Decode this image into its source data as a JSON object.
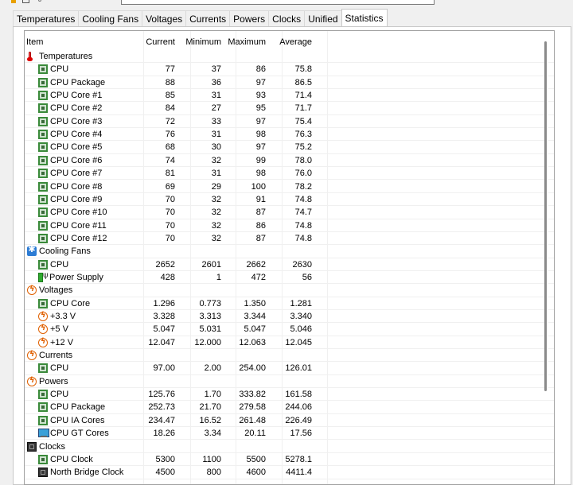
{
  "tabs": [
    "Temperatures",
    "Cooling Fans",
    "Voltages",
    "Currents",
    "Powers",
    "Clocks",
    "Unified",
    "Statistics"
  ],
  "active_tab": "Statistics",
  "columns": {
    "item": "Item",
    "current": "Current",
    "minimum": "Minimum",
    "maximum": "Maximum",
    "average": "Average"
  },
  "rows": [
    {
      "type": "group",
      "icon": "thermometer-icon",
      "label": "Temperatures"
    },
    {
      "type": "item",
      "icon": "cpu-chip-icon",
      "label": "CPU",
      "current": "77",
      "min": "37",
      "max": "86",
      "avg": "75.8"
    },
    {
      "type": "item",
      "icon": "cpu-chip-icon",
      "label": "CPU Package",
      "current": "88",
      "min": "36",
      "max": "97",
      "avg": "86.5"
    },
    {
      "type": "item",
      "icon": "cpu-chip-icon",
      "label": "CPU Core #1",
      "current": "85",
      "min": "31",
      "max": "93",
      "avg": "71.4"
    },
    {
      "type": "item",
      "icon": "cpu-chip-icon",
      "label": "CPU Core #2",
      "current": "84",
      "min": "27",
      "max": "95",
      "avg": "71.7"
    },
    {
      "type": "item",
      "icon": "cpu-chip-icon",
      "label": "CPU Core #3",
      "current": "72",
      "min": "33",
      "max": "97",
      "avg": "75.4"
    },
    {
      "type": "item",
      "icon": "cpu-chip-icon",
      "label": "CPU Core #4",
      "current": "76",
      "min": "31",
      "max": "98",
      "avg": "76.3"
    },
    {
      "type": "item",
      "icon": "cpu-chip-icon",
      "label": "CPU Core #5",
      "current": "68",
      "min": "30",
      "max": "97",
      "avg": "75.2"
    },
    {
      "type": "item",
      "icon": "cpu-chip-icon",
      "label": "CPU Core #6",
      "current": "74",
      "min": "32",
      "max": "99",
      "avg": "78.0"
    },
    {
      "type": "item",
      "icon": "cpu-chip-icon",
      "label": "CPU Core #7",
      "current": "81",
      "min": "31",
      "max": "98",
      "avg": "76.0"
    },
    {
      "type": "item",
      "icon": "cpu-chip-icon",
      "label": "CPU Core #8",
      "current": "69",
      "min": "29",
      "max": "100",
      "avg": "78.2"
    },
    {
      "type": "item",
      "icon": "cpu-chip-icon",
      "label": "CPU Core #9",
      "current": "70",
      "min": "32",
      "max": "91",
      "avg": "74.8"
    },
    {
      "type": "item",
      "icon": "cpu-chip-icon",
      "label": "CPU Core #10",
      "current": "70",
      "min": "32",
      "max": "87",
      "avg": "74.7"
    },
    {
      "type": "item",
      "icon": "cpu-chip-icon",
      "label": "CPU Core #11",
      "current": "70",
      "min": "32",
      "max": "86",
      "avg": "74.8"
    },
    {
      "type": "item",
      "icon": "cpu-chip-icon",
      "label": "CPU Core #12",
      "current": "70",
      "min": "32",
      "max": "87",
      "avg": "74.8"
    },
    {
      "type": "group",
      "icon": "fan-icon",
      "label": "Cooling Fans"
    },
    {
      "type": "item",
      "icon": "cpu-chip-icon",
      "label": "CPU",
      "current": "2652",
      "min": "2601",
      "max": "2662",
      "avg": "2630"
    },
    {
      "type": "item",
      "icon": "power-supply-icon",
      "label": "Power Supply",
      "current": "428",
      "min": "1",
      "max": "472",
      "avg": "56"
    },
    {
      "type": "group",
      "icon": "voltage-icon",
      "label": "Voltages"
    },
    {
      "type": "item",
      "icon": "cpu-chip-icon",
      "label": "CPU Core",
      "current": "1.296",
      "min": "0.773",
      "max": "1.350",
      "avg": "1.281"
    },
    {
      "type": "item",
      "icon": "voltage-icon",
      "label": "+3.3 V",
      "current": "3.328",
      "min": "3.313",
      "max": "3.344",
      "avg": "3.340"
    },
    {
      "type": "item",
      "icon": "voltage-icon",
      "label": "+5 V",
      "current": "5.047",
      "min": "5.031",
      "max": "5.047",
      "avg": "5.046"
    },
    {
      "type": "item",
      "icon": "voltage-icon",
      "label": "+12 V",
      "current": "12.047",
      "min": "12.000",
      "max": "12.063",
      "avg": "12.045"
    },
    {
      "type": "group",
      "icon": "voltage-icon",
      "label": "Currents"
    },
    {
      "type": "item",
      "icon": "cpu-chip-icon",
      "label": "CPU",
      "current": "97.00",
      "min": "2.00",
      "max": "254.00",
      "avg": "126.01"
    },
    {
      "type": "group",
      "icon": "voltage-icon",
      "label": "Powers"
    },
    {
      "type": "item",
      "icon": "cpu-chip-icon",
      "label": "CPU",
      "current": "125.76",
      "min": "1.70",
      "max": "333.82",
      "avg": "161.58"
    },
    {
      "type": "item",
      "icon": "cpu-chip-icon",
      "label": "CPU Package",
      "current": "252.73",
      "min": "21.70",
      "max": "279.58",
      "avg": "244.06"
    },
    {
      "type": "item",
      "icon": "cpu-chip-icon",
      "label": "CPU IA Cores",
      "current": "234.47",
      "min": "16.52",
      "max": "261.48",
      "avg": "226.49"
    },
    {
      "type": "item",
      "icon": "gpu-icon",
      "label": "CPU GT Cores",
      "current": "18.26",
      "min": "3.34",
      "max": "20.11",
      "avg": "17.56"
    },
    {
      "type": "group",
      "icon": "clock-chip-icon",
      "label": "Clocks"
    },
    {
      "type": "item",
      "icon": "cpu-chip-icon",
      "label": "CPU Clock",
      "current": "5300",
      "min": "1100",
      "max": "5500",
      "avg": "5278.1"
    },
    {
      "type": "item",
      "icon": "clock-chip-icon",
      "label": "North Bridge Clock",
      "current": "4500",
      "min": "800",
      "max": "4600",
      "avg": "4411.4"
    }
  ]
}
